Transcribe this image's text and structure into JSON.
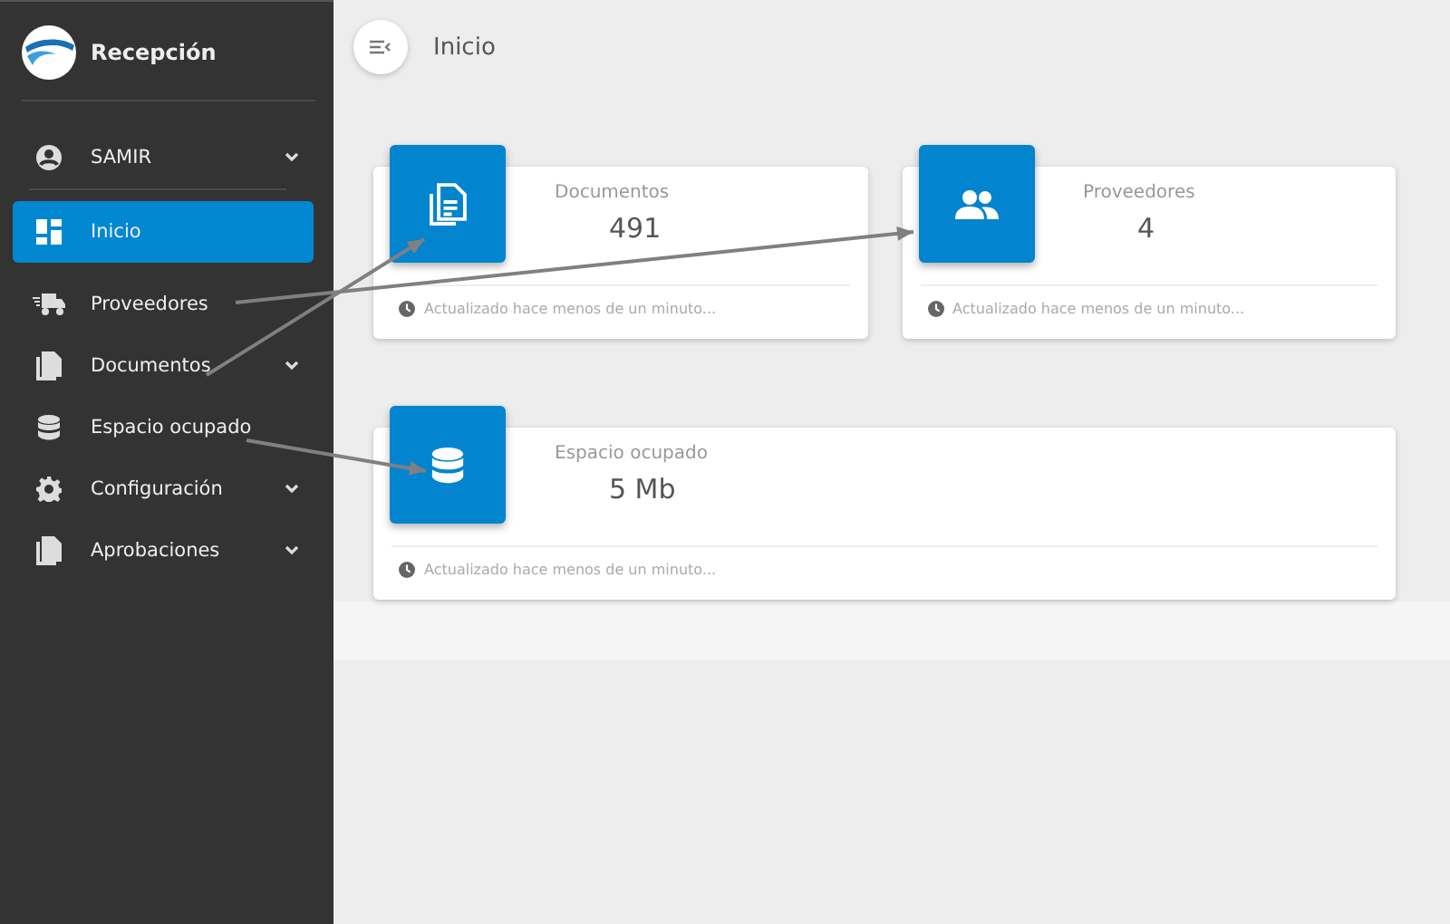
{
  "sidebar": {
    "brand": "Recepción",
    "user": {
      "name": "SAMIR",
      "expandable": true
    },
    "items": [
      {
        "label": "Inicio",
        "selected": true,
        "expandable": false
      },
      {
        "label": "Proveedores",
        "selected": false,
        "expandable": false
      },
      {
        "label": "Documentos",
        "selected": false,
        "expandable": true
      },
      {
        "label": "Espacio ocupado",
        "selected": false,
        "expandable": false
      },
      {
        "label": "Configuración",
        "selected": false,
        "expandable": true
      },
      {
        "label": "Aprobaciones",
        "selected": false,
        "expandable": true
      }
    ]
  },
  "header": {
    "title": "Inicio"
  },
  "cards": [
    {
      "title": "Documentos",
      "value": "491",
      "footer": "Actualizado hace menos de un minuto..."
    },
    {
      "title": "Proveedores",
      "value": "4",
      "footer": "Actualizado hace menos de un minuto..."
    },
    {
      "title": "Espacio ocupado",
      "value": "5 Mb",
      "footer": "Actualizado hace menos de un minuto..."
    }
  ]
}
